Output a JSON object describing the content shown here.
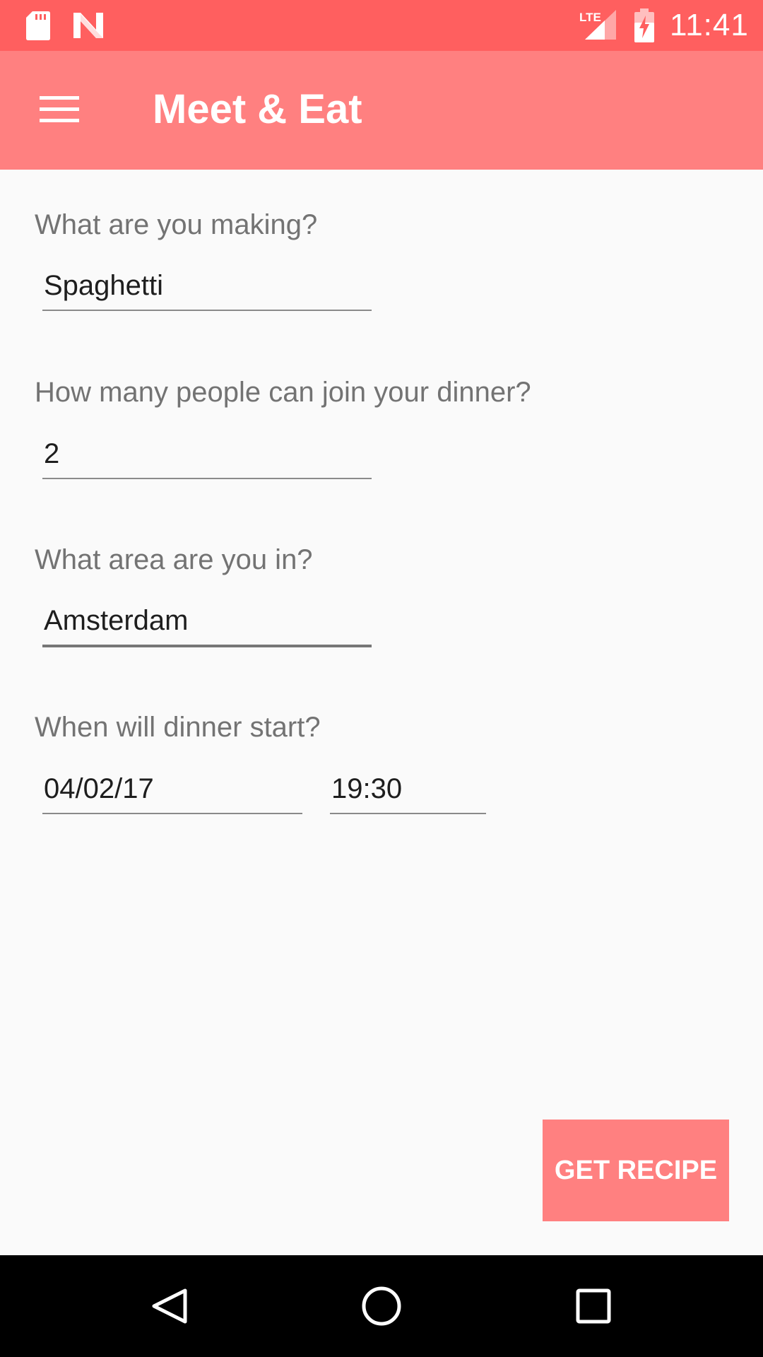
{
  "status_bar": {
    "time": "11:41",
    "network": "LTE",
    "icons": [
      "sd-card-icon",
      "n-notification-icon",
      "lte-signal-icon",
      "battery-charging-icon"
    ]
  },
  "app_bar": {
    "title": "Meet & Eat",
    "menu_icon": "hamburger-menu-icon"
  },
  "form": {
    "dish": {
      "label": "What are you making?",
      "value": "Spaghetti"
    },
    "people": {
      "label": "How many people can join your dinner?",
      "value": "2"
    },
    "area": {
      "label": "What area are you in?",
      "value": "Amsterdam"
    },
    "start": {
      "label": "When will dinner start?",
      "date": "04/02/17",
      "time": "19:30"
    }
  },
  "actions": {
    "get_recipe": "GET RECIPE"
  },
  "navigation": {
    "icons": [
      "back-icon",
      "home-icon",
      "recents-icon"
    ]
  },
  "colors": {
    "status_bar": "#ff5f5f",
    "app_bar": "#ff8080",
    "button": "#ff8080",
    "background": "#fafafa",
    "label_text": "#737373"
  }
}
